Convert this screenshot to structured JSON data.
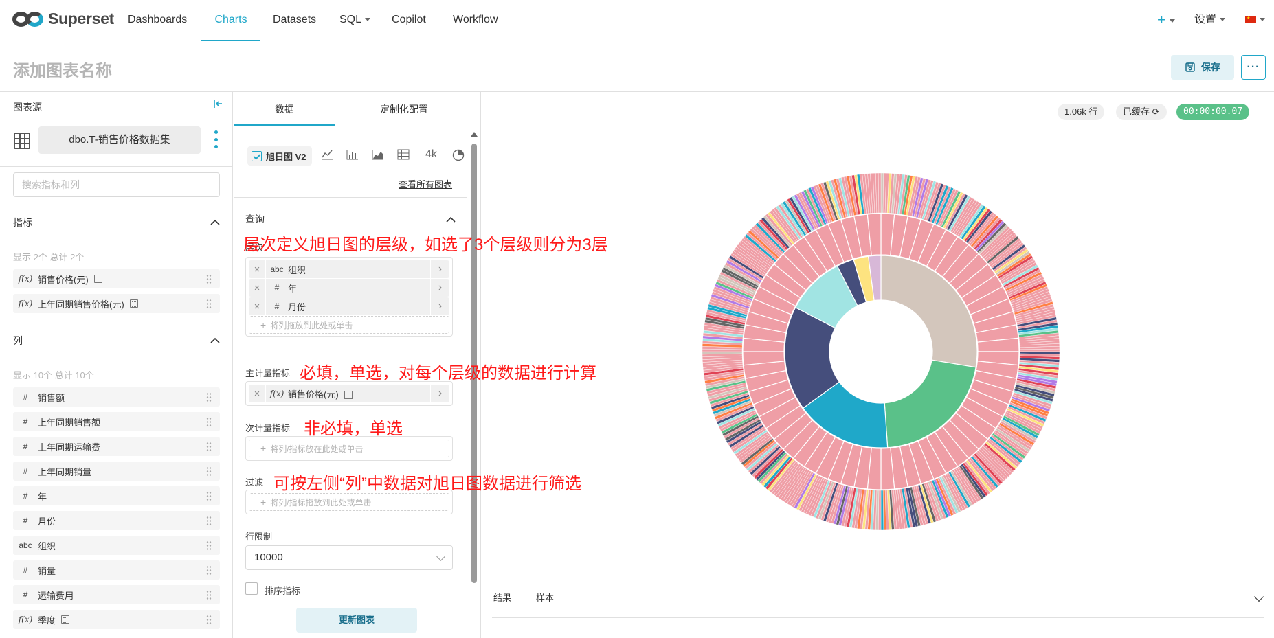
{
  "nav": {
    "brand": "Superset",
    "items": [
      {
        "label": "Dashboards"
      },
      {
        "label": "Charts"
      },
      {
        "label": "Datasets"
      },
      {
        "label": "SQL"
      },
      {
        "label": "Copilot"
      },
      {
        "label": "Workflow"
      }
    ],
    "plus": "+",
    "settings": "设置",
    "lang_flag": "flag-cn-icon",
    "accent": "#20a7c9"
  },
  "header": {
    "title": "添加图表名称",
    "save_label": "保存",
    "more_label": "···"
  },
  "datasource": {
    "title": "图表源",
    "name": "dbo.T-销售价格数据集",
    "search_placeholder": "搜索指标和列",
    "metrics_title": "指标",
    "metrics_count": "显示 2个 总计 2个",
    "metrics": [
      {
        "type": "f(x)",
        "label": "销售价格(元)"
      },
      {
        "type": "f(x)",
        "label": "上年同期销售价格(元)"
      }
    ],
    "columns_title": "列",
    "columns_count": "显示 10个 总计 10个",
    "columns": [
      {
        "type": "#",
        "label": "销售额"
      },
      {
        "type": "#",
        "label": "上年同期销售额"
      },
      {
        "type": "#",
        "label": "上年同期运输费"
      },
      {
        "type": "#",
        "label": "上年同期销量"
      },
      {
        "type": "#",
        "label": "年"
      },
      {
        "type": "#",
        "label": "月份"
      },
      {
        "type": "abc",
        "label": "组织"
      },
      {
        "type": "#",
        "label": "销量"
      },
      {
        "type": "#",
        "label": "运输费用"
      },
      {
        "type": "f(x)",
        "label": "季度"
      }
    ]
  },
  "controls": {
    "tab_data": "数据",
    "tab_custom": "定制化配置",
    "viz_type": "旭日图 V2",
    "viz_4k": "4k",
    "view_all": "查看所有图表",
    "query_title": "查询",
    "hierarchy_label": "层次",
    "hierarchy": [
      {
        "type": "abc",
        "label": "组织"
      },
      {
        "type": "#",
        "label": "年"
      },
      {
        "type": "#",
        "label": "月份"
      }
    ],
    "hierarchy_hint": "将列拖放到此处或单击",
    "primary_metric_label": "主计量指标",
    "primary_metric": {
      "type": "f(x)",
      "label": "销售价格(元)"
    },
    "secondary_metric_label": "次计量指标",
    "secondary_hint": "将列/指标放在此处或单击",
    "filter_label": "过滤",
    "filter_hint": "将列/指标拖放到此处或单击",
    "row_limit_label": "行限制",
    "row_limit_value": "10000",
    "sort_label": "排序指标",
    "update_label": "更新图表"
  },
  "annotations": [
    "层次定义旭日图的层级，如选了3个层级则分为3层",
    "必填，单选，对每个层级的数据进行计算",
    "非必填，单选",
    "可按左侧“列”中数据对旭日图数据进行筛选"
  ],
  "chart_panel": {
    "rows": "1.06k 行",
    "cached": "已缓存",
    "timer": "00:00:00.07",
    "result_tab": "结果",
    "sample_tab": "样本"
  },
  "chart_data": {
    "type": "sunburst",
    "inner_ring": [
      {
        "value": 0.276,
        "color": "#d3c6bc"
      },
      {
        "value": 0.213,
        "color": "#5ac189"
      },
      {
        "value": 0.161,
        "color": "#1fa8c9"
      },
      {
        "value": 0.176,
        "color": "#454e7c"
      },
      {
        "value": 0.099,
        "color": "#a1e4e3"
      },
      {
        "value": 0.029,
        "color": "#454e7c"
      },
      {
        "value": 0.025,
        "color": "#fde380"
      },
      {
        "value": 0.021,
        "color": "#d8b8d8"
      }
    ],
    "middle_ring": {
      "segments": 64,
      "color": "#ef9ea6"
    },
    "outer_ring": {
      "segments": 420,
      "note_colors": [
        "#ef9ea6",
        "#ff7f44",
        "#5ac189",
        "#1fa8c9",
        "#454e7c",
        "#fde380",
        "#d3c6bc",
        "#a1e4e3",
        "#666666",
        "#e04355",
        "#b17be6"
      ]
    }
  }
}
